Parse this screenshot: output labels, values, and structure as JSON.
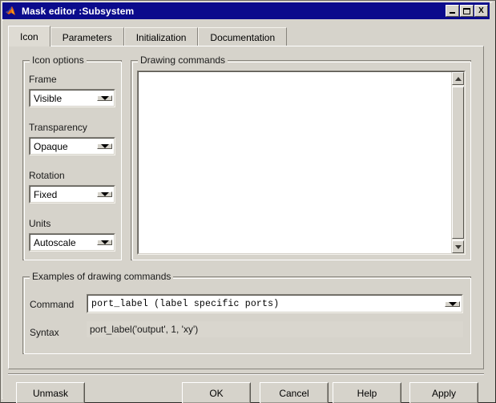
{
  "window": {
    "title": "Mask editor :Subsystem",
    "icon": "matlab-membrane-icon",
    "titlebar_color": "#0b0b8c",
    "face_color": "#d6d3cb",
    "controls": {
      "minimize_label": "Minimize",
      "maximize_label": "Maximize",
      "close_label": "X"
    }
  },
  "tabs": [
    {
      "label": "Icon",
      "active": true
    },
    {
      "label": "Parameters",
      "active": false
    },
    {
      "label": "Initialization",
      "active": false
    },
    {
      "label": "Documentation",
      "active": false
    }
  ],
  "icon_options": {
    "group_title": "Icon options",
    "fields": [
      {
        "label": "Frame",
        "value": "Visible"
      },
      {
        "label": "Transparency",
        "value": "Opaque"
      },
      {
        "label": "Rotation",
        "value": "Fixed"
      },
      {
        "label": "Units",
        "value": "Autoscale"
      }
    ]
  },
  "drawing_commands": {
    "group_title": "Drawing commands",
    "text": "",
    "scrollbar": {
      "up_arrow": "scroll-up-icon",
      "down_arrow": "scroll-down-icon"
    }
  },
  "examples": {
    "group_title": "Examples of drawing commands",
    "command_label": "Command",
    "command_value": "port_label (label specific ports)",
    "syntax_label": "Syntax",
    "syntax_value": "port_label('output', 1, 'xy')"
  },
  "buttons": {
    "unmask": "Unmask",
    "ok": "OK",
    "cancel": "Cancel",
    "help": "Help",
    "apply": "Apply"
  }
}
